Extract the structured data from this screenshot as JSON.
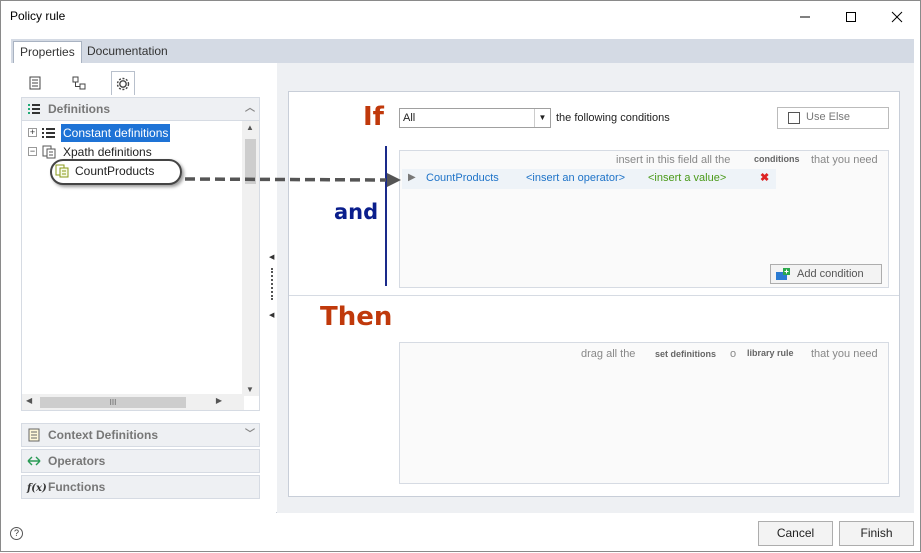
{
  "window": {
    "title": "Policy rule"
  },
  "tabs": [
    {
      "label": "Properties"
    },
    {
      "label": "Documentation"
    }
  ],
  "left": {
    "sections": {
      "definitions": "Definitions",
      "context": "Context Definitions",
      "operators": "Operators",
      "functions": "Functions"
    },
    "tree": {
      "constant": "Constant definitions",
      "xpath": "Xpath definitions",
      "child": "CountProducts"
    },
    "hscroll_grip": "III"
  },
  "rule": {
    "if_kw": "If",
    "and_kw": "and",
    "then_kw": "Then",
    "match_select": "All",
    "following_text": "the following conditions",
    "use_else": "Use Else",
    "cond_hint_pre": "insert in this field all the",
    "cond_hint_bold": "conditions",
    "cond_hint_post": "that you need",
    "condition": {
      "field": "CountProducts",
      "operator": "<insert an operator>",
      "value": "<insert a value>"
    },
    "add_condition": "Add condition",
    "then_hint_pre": "drag all the",
    "then_hint_bold1": "set definitions",
    "then_hint_mid": "o",
    "then_hint_bold2": "library rule",
    "then_hint_post": "that you need"
  },
  "footer": {
    "cancel": "Cancel",
    "finish": "Finish",
    "help_icon": "?"
  },
  "colors": {
    "keyword_red": "#c0390b",
    "keyword_blue": "#0a1e8c",
    "selection": "#1e73d6"
  }
}
